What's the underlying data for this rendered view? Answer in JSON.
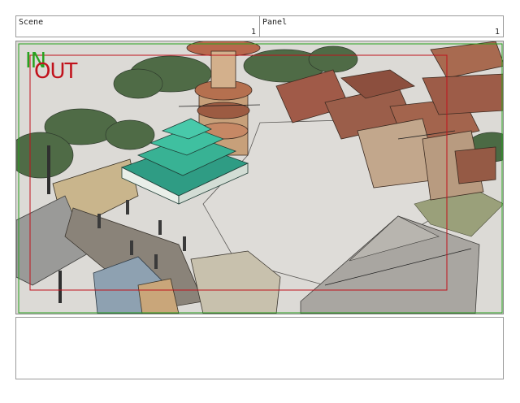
{
  "header": {
    "scene_label": "Scene",
    "scene_value": "1",
    "panel_label": "Panel",
    "panel_value": "1"
  },
  "frame": {
    "in_label": "IN",
    "out_label": "OUT",
    "in_color": "#27a31f",
    "out_color": "#c1121c"
  },
  "notes": {
    "text": ""
  }
}
